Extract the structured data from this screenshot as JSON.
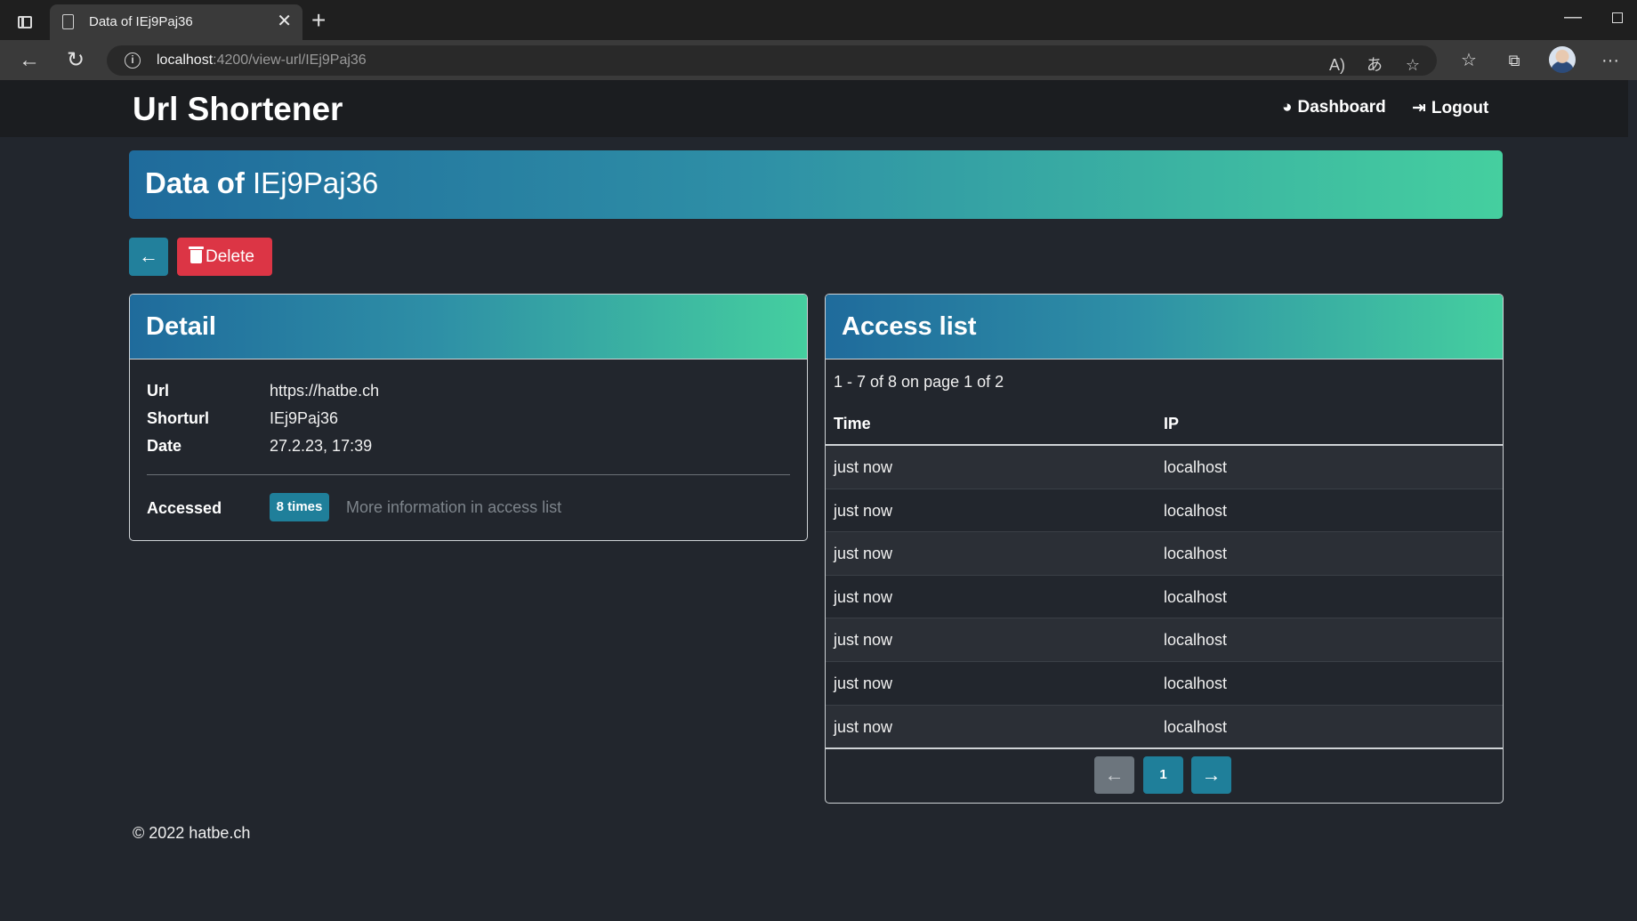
{
  "browser": {
    "tab_title": "Data of IEj9Paj36",
    "tab_close": "✕",
    "new_tab": "+",
    "url_host": "localhost",
    "url_rest": ":4200/view-url/IEj9Paj36",
    "minimize": "—"
  },
  "header": {
    "brand": "Url Shortener",
    "dashboard_label": "Dashboard",
    "logout_label": "Logout"
  },
  "banner": {
    "prefix": "Data of",
    "code": "IEj9Paj36"
  },
  "actions": {
    "back_arrow": "←",
    "delete_label": "Delete"
  },
  "detail": {
    "title": "Detail",
    "url_key": "Url",
    "url_value": "https://hatbe.ch",
    "shorturl_key": "Shorturl",
    "shorturl_value": "IEj9Paj36",
    "date_key": "Date",
    "date_value": "27.2.23, 17:39",
    "accessed_key": "Accessed",
    "accessed_badge": "8 times",
    "more_info": "More information in access list"
  },
  "access": {
    "title": "Access list",
    "range": "1 - 7 of 8 on page 1 of 2",
    "col_time": "Time",
    "col_ip": "IP",
    "rows": [
      {
        "time": "just now",
        "ip": "localhost"
      },
      {
        "time": "just now",
        "ip": "localhost"
      },
      {
        "time": "just now",
        "ip": "localhost"
      },
      {
        "time": "just now",
        "ip": "localhost"
      },
      {
        "time": "just now",
        "ip": "localhost"
      },
      {
        "time": "just now",
        "ip": "localhost"
      },
      {
        "time": "just now",
        "ip": "localhost"
      }
    ],
    "pager_prev": "←",
    "pager_page": "1",
    "pager_next": "→"
  },
  "footer": {
    "text": "© 2022 hatbe.ch"
  },
  "colors": {
    "accent": "#1f7f9a",
    "danger": "#dc3545",
    "gradient_start": "#1f6b9c",
    "gradient_end": "#45cf9f",
    "background": "#22262d"
  }
}
